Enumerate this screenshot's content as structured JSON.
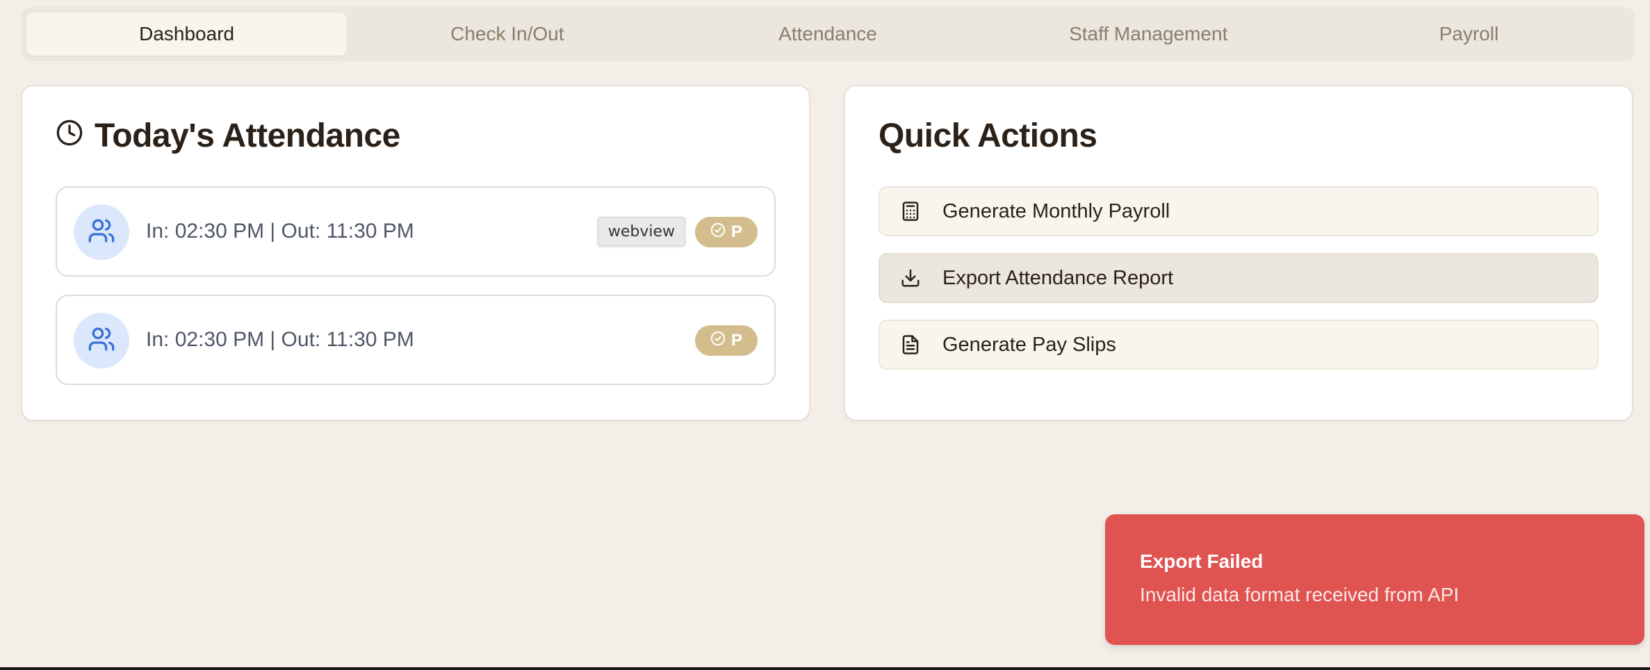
{
  "tabs": [
    {
      "label": "Dashboard",
      "active": true
    },
    {
      "label": "Check In/Out",
      "active": false
    },
    {
      "label": "Attendance",
      "active": false
    },
    {
      "label": "Staff Management",
      "active": false
    },
    {
      "label": "Payroll",
      "active": false
    }
  ],
  "attendance": {
    "title": "Today's Attendance",
    "title_icon": "clock-icon",
    "rows": [
      {
        "times": "In: 02:30 PM | Out: 11:30 PM",
        "status": "P",
        "status_icon": "check-circle-icon",
        "avatar_icon": "users-icon"
      },
      {
        "times": "In: 02:30 PM | Out: 11:30 PM",
        "status": "P",
        "status_icon": "check-circle-icon",
        "avatar_icon": "users-icon"
      }
    ],
    "tooltip": "webview"
  },
  "quick_actions": {
    "title": "Quick Actions",
    "items": [
      {
        "label": "Generate Monthly Payroll",
        "icon": "calculator-icon"
      },
      {
        "label": "Export Attendance Report",
        "icon": "download-icon"
      },
      {
        "label": "Generate Pay Slips",
        "icon": "file-text-icon"
      }
    ]
  },
  "toast": {
    "title": "Export Failed",
    "message": "Invalid data format received from API"
  },
  "colors": {
    "background": "#f3efe8",
    "status_badge": "#d4bd8d",
    "avatar_bg": "#dbe8fb",
    "avatar_icon": "#3b6fd8",
    "toast_error": "#df5350"
  }
}
